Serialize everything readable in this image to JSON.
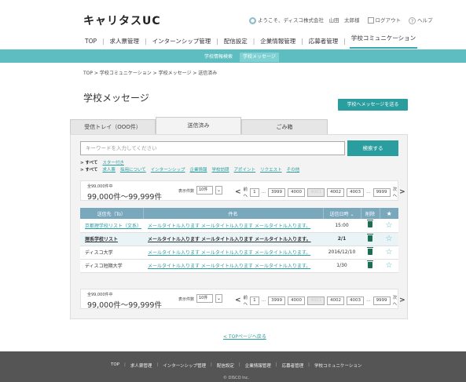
{
  "header": {
    "logo": "キャリタスUC",
    "welcome": "ようこそ、ディスコ株式会社　山田　太郎様",
    "logout": "ログアウト",
    "help": "ヘルプ"
  },
  "nav": [
    "TOP",
    "求人票管理",
    "インターンシップ管理",
    "配信設定",
    "企業情報管理",
    "応募者管理",
    "学校コミュニケーション"
  ],
  "subnav": [
    "学校情報検索",
    "学校メッセージ"
  ],
  "breadcrumb": "TOP > 学校コミュニケーション > 学校メッセージ > 送信済み",
  "page_title": "学校メッセージ",
  "send_button": "学校へメッセージを送る",
  "tabs": [
    "受信トレイ（OOO件）",
    "送信済み",
    "ごみ箱"
  ],
  "search": {
    "placeholder": "キーワードを入力してください",
    "button": "検索する"
  },
  "filters": {
    "row1": [
      "> すべて",
      "スター付き"
    ],
    "row2": [
      "> すべて",
      "求人票",
      "採用について",
      "インターンシップ",
      "企業情報",
      "学校訪問",
      "アポイント",
      "リクエスト",
      "その他"
    ]
  },
  "pager": {
    "total_label": "全99,000件中",
    "range": "99,000件～99,999件",
    "per_page_label": "表示件数",
    "per_page_value": "10件",
    "prev": "前へ",
    "next": "次へ",
    "pages": [
      "1",
      "…",
      "3999",
      "4000",
      "4001",
      "4002",
      "4003",
      "…",
      "9999"
    ]
  },
  "table": {
    "headers": [
      "送信先（To）",
      "件名",
      "送信日時",
      "削除"
    ],
    "rows": [
      {
        "to": "京都理学校リスト（文系）",
        "subject": "メールタイトル入ります メールタイトル入ります メールタイトル入ります。",
        "date": "15:00"
      },
      {
        "to": "理系学校リスト",
        "subject": "メールタイトル入ります メールタイトル入ります メールタイトル入ります。",
        "date": "2/1"
      },
      {
        "to": "ディスコ大学",
        "subject": "メールタイトル入ります メールタイトル入ります メールタイトル入ります。",
        "date": "2016/12/10"
      },
      {
        "to": "ディスコ短期大学",
        "subject": "メールタイトル入ります メールタイトル入ります メールタイトル入ります。",
        "date": "1/30"
      }
    ]
  },
  "back_link": "< TOPページへ戻る",
  "footer": {
    "links": [
      "TOP",
      "求人票管理",
      "インターンシップ管理",
      "配信設定",
      "企業情報管理",
      "応募者管理",
      "学校コミュニケーション"
    ],
    "copyright": "© DISCO Inc."
  }
}
